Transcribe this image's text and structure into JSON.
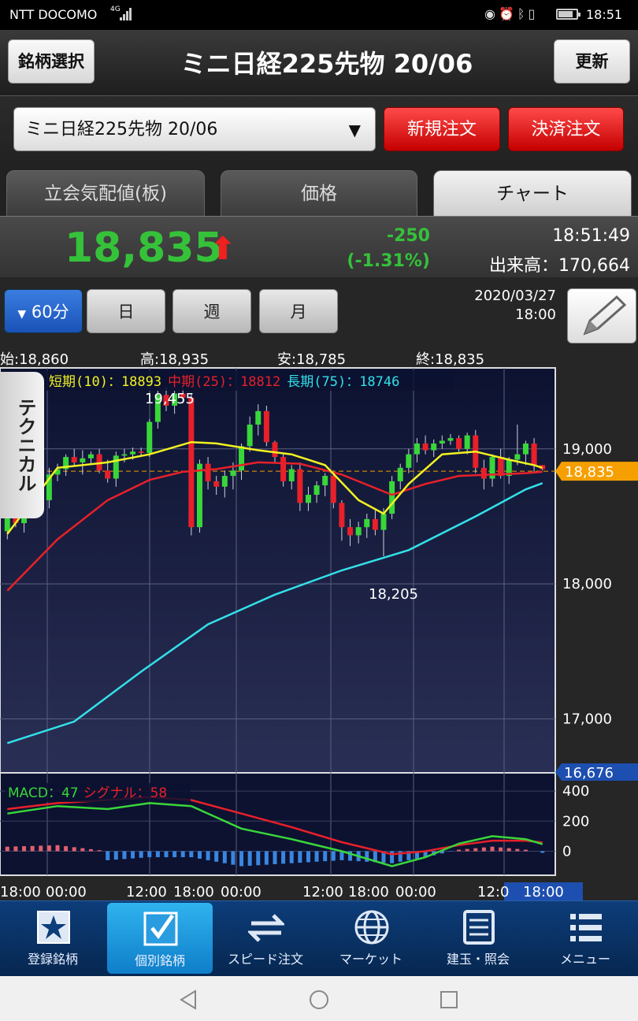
{
  "statusbar": {
    "carrier": "NTT DOCOMO",
    "network": "4G",
    "time": "18:51",
    "icons": [
      "eye-icon",
      "alarm-icon",
      "bluetooth-icon",
      "vibrate-icon"
    ]
  },
  "header": {
    "left_button": "銘柄選択",
    "title": "ミニ日経225先物 20/06",
    "right_button": "更新"
  },
  "selector": {
    "value": "ミニ日経225先物 20/06",
    "new_order": "新規注文",
    "settle_order": "決済注文"
  },
  "tabs": [
    {
      "label": "立会気配値(板)",
      "active": false
    },
    {
      "label": "価格",
      "active": false
    },
    {
      "label": "チャート",
      "active": true
    }
  ],
  "price": {
    "last": "18,835",
    "direction": "up",
    "change": "-250",
    "change_pct": "(-1.31%)",
    "time": "18:51:49",
    "volume": "出来高：170,664"
  },
  "period": {
    "buttons": [
      "60分",
      "日",
      "週",
      "月"
    ],
    "active": "60分",
    "date": "2020/03/27",
    "time": "18:00"
  },
  "ohlc": {
    "open": "始:18,860",
    "high": "高:18,935",
    "low": "安:18,785",
    "close": "終:18,835"
  },
  "technical_tab": "テクニカル",
  "legend": {
    "short": "短期(10)：18893",
    "mid": "中期(25)：18812",
    "long": "長期(75)：18746",
    "macd": "MACD：47",
    "signal": "シグナル：58"
  },
  "annotations": {
    "max": "19,455",
    "min": "18,205"
  },
  "price_axis": {
    "ticks": [
      "19,000",
      "18,000",
      "17,000"
    ],
    "current": "18,835",
    "marker": "16,676"
  },
  "macd_axis": {
    "ticks": [
      "400",
      "200",
      "0"
    ]
  },
  "time_axis": {
    "labels": [
      "18:00",
      "00:00",
      "12:00",
      "18:00",
      "00:00",
      "12:00",
      "18:00",
      "00:00",
      "12:0",
      "18:00"
    ]
  },
  "colors": {
    "up": "#39d63a",
    "down": "#e8202a",
    "short": "#f2f221",
    "mid": "#e8202a",
    "long": "#33e0e8",
    "macd": "#39d63a",
    "signal": "#e8202a",
    "hist_pos": "#e06070",
    "hist_neg": "#3a86e0",
    "accent": "#f5a000",
    "chart_bg": "#101a3a"
  },
  "chart_data": {
    "type": "candlestick",
    "interval": "60分",
    "ylim": [
      16600,
      19600
    ],
    "candles": [
      [
        18390,
        18560,
        18330,
        18520
      ],
      [
        18520,
        18620,
        18420,
        18450
      ],
      [
        18450,
        18820,
        18380,
        18790
      ],
      [
        18790,
        18830,
        18680,
        18700
      ],
      [
        18700,
        18820,
        18600,
        18620
      ],
      [
        18620,
        18860,
        18560,
        18810
      ],
      [
        18810,
        18890,
        18760,
        18850
      ],
      [
        18850,
        18960,
        18800,
        18940
      ],
      [
        18940,
        19000,
        18870,
        18900
      ],
      [
        18900,
        18990,
        18810,
        18930
      ],
      [
        18930,
        18980,
        18880,
        18960
      ],
      [
        18960,
        19000,
        18820,
        18840
      ],
      [
        18840,
        18920,
        18750,
        18780
      ],
      [
        18780,
        18980,
        18720,
        18950
      ],
      [
        18950,
        19000,
        18900,
        18960
      ],
      [
        18960,
        19010,
        18920,
        18980
      ],
      [
        18980,
        19010,
        18940,
        18970
      ],
      [
        18970,
        19220,
        18940,
        19200
      ],
      [
        19200,
        19430,
        19150,
        19400
      ],
      [
        19400,
        19455,
        19280,
        19320
      ],
      [
        19320,
        19430,
        19260,
        19410
      ],
      [
        19410,
        19450,
        19340,
        19380
      ],
      [
        19380,
        19410,
        18360,
        18420
      ],
      [
        18420,
        18920,
        18380,
        18890
      ],
      [
        18890,
        18940,
        18700,
        18760
      ],
      [
        18760,
        18800,
        18660,
        18720
      ],
      [
        18720,
        18840,
        18640,
        18800
      ],
      [
        18800,
        18900,
        18700,
        18840
      ],
      [
        18840,
        19040,
        18770,
        19020
      ],
      [
        19020,
        19240,
        18980,
        19180
      ],
      [
        19180,
        19330,
        19100,
        19280
      ],
      [
        19280,
        19320,
        19020,
        19050
      ],
      [
        19050,
        19060,
        18900,
        18940
      ],
      [
        18940,
        18960,
        18720,
        18760
      ],
      [
        18760,
        18880,
        18700,
        18850
      ],
      [
        18850,
        18900,
        18540,
        18600
      ],
      [
        18600,
        18720,
        18540,
        18660
      ],
      [
        18660,
        18760,
        18600,
        18730
      ],
      [
        18730,
        18820,
        18650,
        18800
      ],
      [
        18800,
        18840,
        18560,
        18600
      ],
      [
        18600,
        18620,
        18320,
        18420
      ],
      [
        18420,
        18480,
        18280,
        18360
      ],
      [
        18360,
        18460,
        18300,
        18420
      ],
      [
        18420,
        18520,
        18340,
        18480
      ],
      [
        18480,
        18550,
        18360,
        18400
      ],
      [
        18400,
        18560,
        18205,
        18520
      ],
      [
        18520,
        18800,
        18480,
        18760
      ],
      [
        18760,
        18890,
        18700,
        18860
      ],
      [
        18860,
        19000,
        18820,
        18960
      ],
      [
        18960,
        19080,
        18900,
        19040
      ],
      [
        19040,
        19100,
        18960,
        18990
      ],
      [
        18990,
        19070,
        18940,
        19040
      ],
      [
        19040,
        19100,
        19000,
        19060
      ],
      [
        19060,
        19110,
        19030,
        19080
      ],
      [
        19080,
        19100,
        18980,
        19000
      ],
      [
        19000,
        19120,
        18960,
        19100
      ],
      [
        19100,
        19140,
        18820,
        18860
      ],
      [
        18860,
        18920,
        18700,
        18780
      ],
      [
        18780,
        18960,
        18720,
        18940
      ],
      [
        18940,
        19000,
        18780,
        18800
      ],
      [
        18800,
        18940,
        18740,
        18920
      ],
      [
        18920,
        19180,
        18880,
        18960
      ],
      [
        18960,
        19060,
        18880,
        19040
      ],
      [
        19040,
        19080,
        18820,
        18880
      ],
      [
        18880,
        18880,
        18840,
        18850
      ]
    ],
    "sma": {
      "short": [
        [
          0,
          18370
        ],
        [
          6,
          18860
        ],
        [
          12,
          18900
        ],
        [
          17,
          18960
        ],
        [
          22,
          19050
        ],
        [
          25,
          19040
        ],
        [
          30,
          18990
        ],
        [
          34,
          18960
        ],
        [
          38,
          18880
        ],
        [
          42,
          18620
        ],
        [
          45,
          18520
        ],
        [
          48,
          18740
        ],
        [
          52,
          18960
        ],
        [
          56,
          18980
        ],
        [
          60,
          18920
        ],
        [
          63,
          18880
        ],
        [
          64,
          18860
        ]
      ],
      "mid": [
        [
          0,
          17950
        ],
        [
          6,
          18330
        ],
        [
          12,
          18620
        ],
        [
          17,
          18770
        ],
        [
          21,
          18830
        ],
        [
          25,
          18850
        ],
        [
          30,
          18900
        ],
        [
          35,
          18890
        ],
        [
          40,
          18810
        ],
        [
          44,
          18710
        ],
        [
          46,
          18660
        ],
        [
          50,
          18740
        ],
        [
          54,
          18800
        ],
        [
          58,
          18810
        ],
        [
          62,
          18820
        ],
        [
          64,
          18830
        ]
      ],
      "long": [
        [
          0,
          16820
        ],
        [
          8,
          16980
        ],
        [
          16,
          17350
        ],
        [
          24,
          17700
        ],
        [
          32,
          17920
        ],
        [
          40,
          18100
        ],
        [
          48,
          18250
        ],
        [
          56,
          18500
        ],
        [
          62,
          18700
        ],
        [
          64,
          18746
        ]
      ]
    },
    "macd": {
      "macd": [
        [
          0,
          250
        ],
        [
          6,
          300
        ],
        [
          12,
          280
        ],
        [
          17,
          320
        ],
        [
          22,
          300
        ],
        [
          28,
          150
        ],
        [
          34,
          80
        ],
        [
          40,
          0
        ],
        [
          46,
          -100
        ],
        [
          50,
          -40
        ],
        [
          54,
          50
        ],
        [
          58,
          100
        ],
        [
          62,
          80
        ],
        [
          64,
          47
        ]
      ],
      "signal": [
        [
          0,
          280
        ],
        [
          6,
          320
        ],
        [
          12,
          340
        ],
        [
          17,
          360
        ],
        [
          22,
          340
        ],
        [
          28,
          250
        ],
        [
          34,
          160
        ],
        [
          40,
          60
        ],
        [
          46,
          -20
        ],
        [
          50,
          0
        ],
        [
          54,
          40
        ],
        [
          58,
          70
        ],
        [
          62,
          70
        ],
        [
          64,
          58
        ]
      ],
      "ylim": [
        -160,
        500
      ]
    }
  }
}
